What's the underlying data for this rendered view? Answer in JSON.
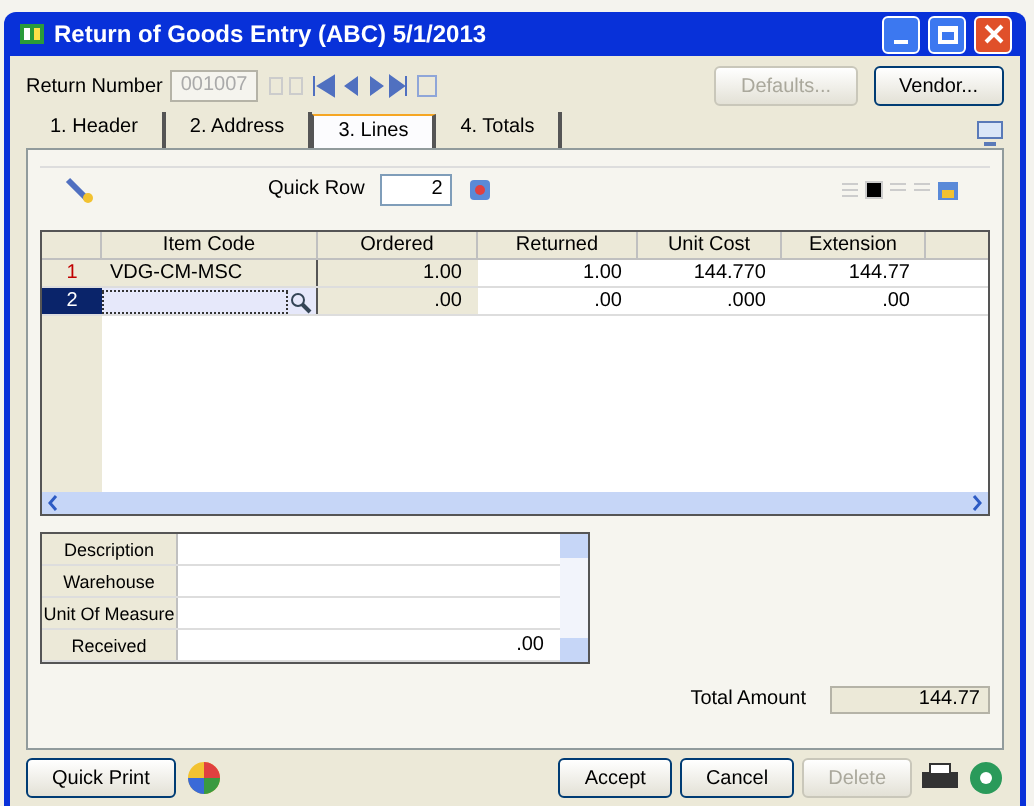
{
  "window": {
    "title": "Return of Goods Entry (ABC) 5/1/2013"
  },
  "header": {
    "return_number_label": "Return Number",
    "return_number": "001007",
    "buttons": [
      {
        "label": "Defaults...",
        "disabled": true
      },
      {
        "label": "Vendor...",
        "disabled": false
      }
    ]
  },
  "tabs": [
    {
      "label": "1. Header",
      "selected": false
    },
    {
      "label": "2. Address",
      "selected": false
    },
    {
      "label": "3. Lines",
      "selected": true
    },
    {
      "label": "4. Totals",
      "selected": false
    }
  ],
  "toolbar": {
    "quick_row_label": "Quick Row",
    "quick_row": "2"
  },
  "table": {
    "columns": [
      "Item Code",
      "Ordered",
      "Returned",
      "Unit Cost",
      "Extension"
    ],
    "rows": [
      {
        "number": "1",
        "selected": false,
        "cells": [
          "VDG-CM-MSC",
          "1.00",
          "1.00",
          "144.770",
          "144.77"
        ]
      },
      {
        "number": "2",
        "selected": true,
        "cells": [
          "",
          ".00",
          ".00",
          ".000",
          ".00"
        ]
      }
    ]
  },
  "details": [
    {
      "label": "Description"
    },
    {
      "label": "Warehouse"
    },
    {
      "label": "Unit Of Measure"
    },
    {
      "label": "Received",
      "value": ".00"
    }
  ],
  "total": {
    "label": "Total Amount",
    "value": "144.77"
  },
  "footer": {
    "left_button": "Quick Print",
    "buttons": [
      {
        "label": "Accept",
        "disabled": false
      },
      {
        "label": "Cancel",
        "disabled": false
      },
      {
        "label": "Delete",
        "disabled": true
      }
    ]
  }
}
